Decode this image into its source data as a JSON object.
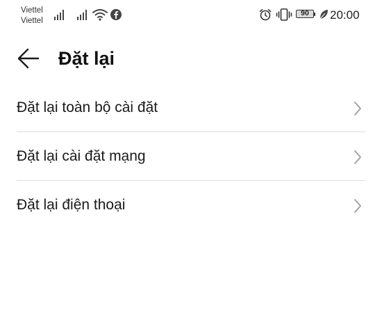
{
  "status_bar": {
    "carriers": [
      "Viettel",
      "Viettel"
    ],
    "battery_percent": "90",
    "time": "20:00",
    "icons": [
      "signal-icon",
      "signal-icon",
      "wifi-icon",
      "facebook-icon",
      "alarm-icon",
      "vibrate-icon",
      "battery-icon",
      "leaf-icon"
    ]
  },
  "header": {
    "title": "Đặt lại",
    "back_icon": "arrow-left-icon"
  },
  "list": {
    "items": [
      {
        "label": "Đặt lại toàn bộ cài đặt",
        "icon": "chevron-right-icon"
      },
      {
        "label": "Đặt lại cài đặt mạng",
        "icon": "chevron-right-icon"
      },
      {
        "label": "Đặt lại điện thoại",
        "icon": "chevron-right-icon"
      }
    ]
  },
  "colors": {
    "background": "#ffffff",
    "text": "#1a1a1a",
    "divider": "#dedede",
    "chevron": "#9e9e9e"
  }
}
